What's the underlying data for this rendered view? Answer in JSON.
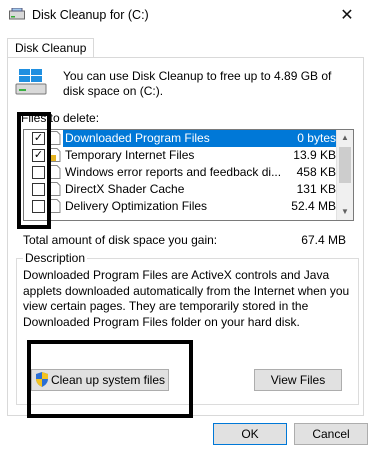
{
  "window": {
    "title": "Disk Cleanup for  (C:)",
    "close_glyph": "✕"
  },
  "tab": {
    "label": "Disk Cleanup"
  },
  "intro": {
    "text": "You can use Disk Cleanup to free up to 4.89 GB of disk space on  (C:)."
  },
  "files_label": "Files to delete:",
  "files": [
    {
      "checked": true,
      "selected": true,
      "name": "Downloaded Program Files",
      "size": "0 bytes"
    },
    {
      "checked": true,
      "selected": false,
      "name": "Temporary Internet Files",
      "size": "13.9 KB"
    },
    {
      "checked": false,
      "selected": false,
      "name": "Windows error reports and feedback di...",
      "size": "458 KB"
    },
    {
      "checked": false,
      "selected": false,
      "name": "DirectX Shader Cache",
      "size": "131 KB"
    },
    {
      "checked": false,
      "selected": false,
      "name": "Delivery Optimization Files",
      "size": "52.4 MB"
    }
  ],
  "check_glyph": "✓",
  "total": {
    "label": "Total amount of disk space you gain:",
    "value": "67.4 MB"
  },
  "description": {
    "title": "Description",
    "text": "Downloaded Program Files are ActiveX controls and Java applets downloaded automatically from the Internet when you view certain pages. They are temporarily stored in the Downloaded Program Files folder on your hard disk."
  },
  "buttons": {
    "cleanup_system": "Clean up system files",
    "view_files": "View Files",
    "ok": "OK",
    "cancel": "Cancel"
  },
  "colors": {
    "selection": "#0078d7",
    "annotation": "#000000"
  }
}
